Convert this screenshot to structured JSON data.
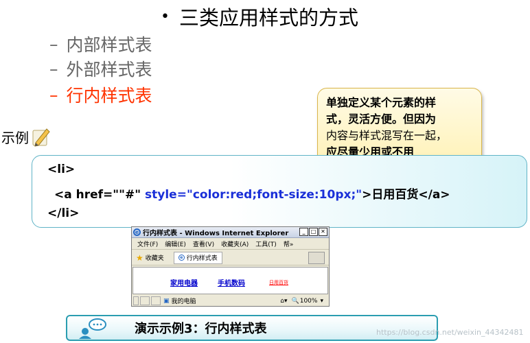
{
  "title": "三类应用样式的方式",
  "items": [
    {
      "label": "内部样式表",
      "active": false
    },
    {
      "label": "外部样式表",
      "active": false
    },
    {
      "label": "行内样式表",
      "active": true
    }
  ],
  "callout": {
    "line1": "单独定义某个元素的样",
    "line2a": "式，灵活方便。",
    "line2b": "但因为",
    "line3": "内容与样式混写在一起，",
    "line4": "应尽量少用或不用"
  },
  "example_label": "示例",
  "code": {
    "line1": "<li>",
    "line2a": "<a href=\"\"#\" ",
    "line2b": "style=\"color:red;font-size:10px;\"",
    "line2c": ">日用百货</a>",
    "line3": "</li>"
  },
  "ie": {
    "title": "行内样式表 - Windows Internet Explorer",
    "menu": [
      "文件(F)",
      "编辑(E)",
      "查看(V)",
      "收藏夹(A)",
      "工具(T)",
      "帮»"
    ],
    "favorites": "收藏夹",
    "tab": "行内样式表",
    "links": [
      "家用电器",
      "手机数码",
      "日用百货"
    ],
    "status_computer": "我的电脑",
    "zoom": "100%"
  },
  "demo": {
    "label": "演示示例3：行内样式表"
  },
  "watermark": "https://blog.csdn.net/weixin_44342481",
  "colors": {
    "active": "#ff3300",
    "code_blue": "#1a2fd8",
    "box_border": "#5fb3c6"
  }
}
